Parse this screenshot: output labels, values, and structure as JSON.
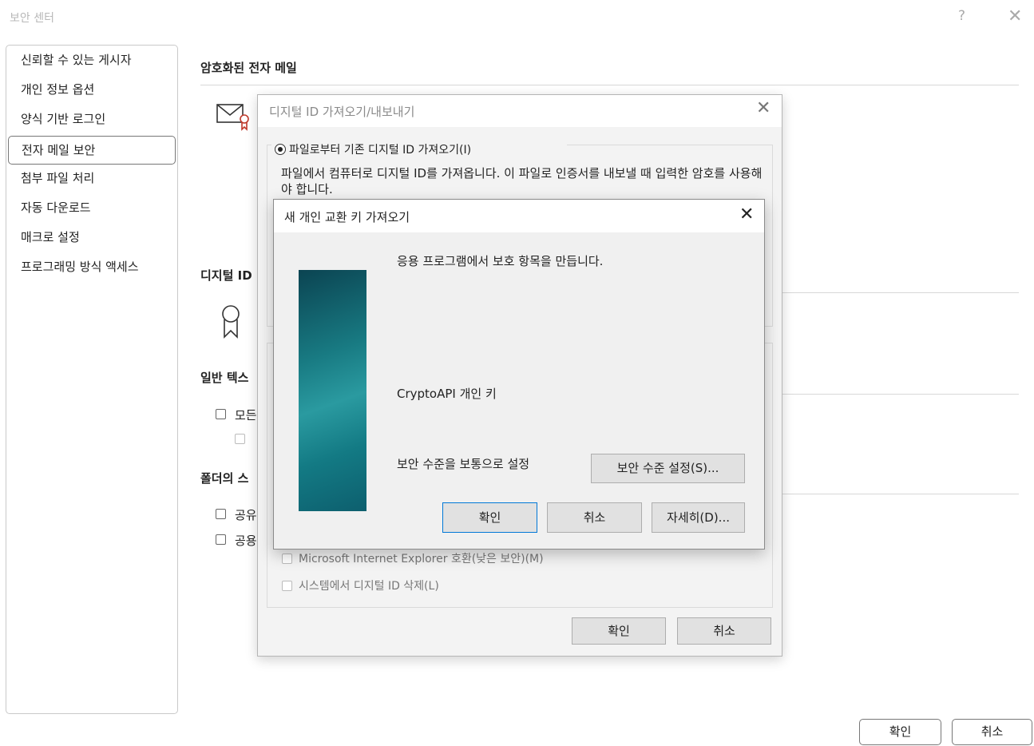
{
  "window": {
    "title": "보안 센터",
    "help": "?",
    "close": "✕"
  },
  "sidebar": {
    "items": [
      {
        "label": "신뢰할 수 있는 게시자"
      },
      {
        "label": "개인 정보 옵션"
      },
      {
        "label": "양식 기반 로그인"
      },
      {
        "label": "전자 메일 보안",
        "selected": true
      },
      {
        "label": "첨부 파일 처리"
      },
      {
        "label": "자동 다운로드"
      },
      {
        "label": "매크로 설정"
      },
      {
        "label": "프로그래밍 방식 액세스"
      }
    ]
  },
  "main": {
    "encrypted_heading": "암호화된 전자 메일",
    "digital_id_heading": "디지털 ID",
    "plaintext_heading": "일반 텍스",
    "plaintext_cb1": "모든",
    "plaintext_cb2": "",
    "folder_heading": "폴더의 스",
    "folder_cb1": "공유",
    "folder_cb2": "공용"
  },
  "import_dialog": {
    "title": "디지털 ID 가져오기/내보내기",
    "radio_label": "파일로부터 기존 디지털 ID 가져오기(I)",
    "description": "파일에서 컴퓨터로 디지털 ID를 가져옵니다. 이 파일로 인증서를 내보낼 때 입력한 암호를 사용해야 합니다.",
    "ie_compat": "Microsoft Internet Explorer 호환(낮은 보안)(M)",
    "delete_id": "시스템에서 디지털 ID 삭제(L)",
    "ok": "확인",
    "cancel": "취소"
  },
  "key_dialog": {
    "title": "새 개인 교환 키 가져오기",
    "message": "응용 프로그램에서 보호 항목을 만듭니다.",
    "key_name": "CryptoAPI 개인 키",
    "security_level": "보안 수준을 보통으로 설정",
    "set_level_button": "보안 수준 설정(S)...",
    "ok": "확인",
    "cancel": "취소",
    "details": "자세히(D)..."
  },
  "footer": {
    "ok": "확인",
    "cancel": "취소"
  },
  "colors": {
    "accent": "#0078d7",
    "banner": "#187a82"
  }
}
